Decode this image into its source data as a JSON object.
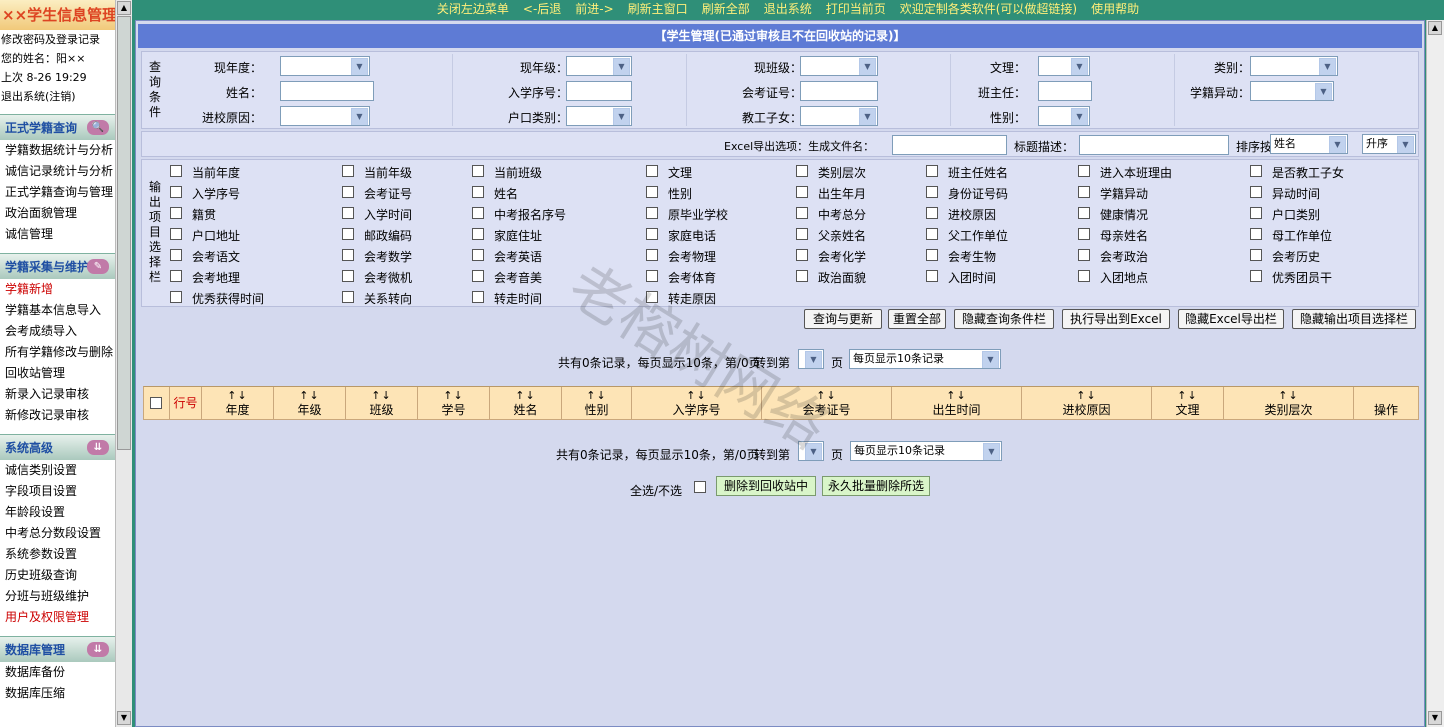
{
  "sidebar": {
    "title": "××学生信息管理",
    "user_links": [
      "修改密码及登录记录",
      "您的姓名：阳××",
      "上次 8-26 19:29",
      "退出系统(注销)"
    ],
    "sections": [
      {
        "title": "正式学籍查询",
        "icon": "magnify-icon",
        "items": [
          {
            "label": "学籍数据统计与分析",
            "highlight": false
          },
          {
            "label": "诚信记录统计与分析",
            "highlight": false
          },
          {
            "label": "正式学籍查询与管理",
            "highlight": false
          },
          {
            "label": "政治面貌管理",
            "highlight": false
          },
          {
            "label": "诚信管理",
            "highlight": false
          }
        ]
      },
      {
        "title": "学籍采集与维护",
        "icon": "edit-icon",
        "items": [
          {
            "label": "学籍新增",
            "highlight": true
          },
          {
            "label": "学籍基本信息导入",
            "highlight": false
          },
          {
            "label": "会考成绩导入",
            "highlight": false
          },
          {
            "label": "所有学籍修改与删除",
            "highlight": false
          },
          {
            "label": "回收站管理",
            "highlight": false
          },
          {
            "label": "新录入记录审核",
            "highlight": false
          },
          {
            "label": "新修改记录审核",
            "highlight": false
          }
        ]
      },
      {
        "title": "系统高级",
        "icon": "arrow-down-icon",
        "items": [
          {
            "label": "诚信类别设置",
            "highlight": false
          },
          {
            "label": "字段项目设置",
            "highlight": false
          },
          {
            "label": "年龄段设置",
            "highlight": false
          },
          {
            "label": "中考总分数段设置",
            "highlight": false
          },
          {
            "label": "系统参数设置",
            "highlight": false
          },
          {
            "label": "历史班级查询",
            "highlight": false
          },
          {
            "label": "分班与班级维护",
            "highlight": false
          },
          {
            "label": "用户及权限管理",
            "highlight": true
          }
        ]
      },
      {
        "title": "数据库管理",
        "icon": "arrow-down-icon",
        "items": [
          {
            "label": "数据库备份",
            "highlight": false
          },
          {
            "label": "数据库压缩",
            "highlight": false
          }
        ]
      }
    ]
  },
  "topnav": [
    "关闭左边菜单",
    "<-后退",
    "前进->",
    "刷新主窗口",
    "刷新全部",
    "退出系统",
    "打印当前页",
    "欢迎定制各类软件(可以做超链接)",
    "使用帮助"
  ],
  "page_title": "【学生管理(已通过审核且不在回收站的记录)】",
  "query": {
    "section_label": "查询条件",
    "row1": [
      {
        "label": "现年度：",
        "type": "select"
      },
      {
        "label": "现年级：",
        "type": "select"
      },
      {
        "label": "现班级：",
        "type": "select"
      },
      {
        "label": "文理：",
        "type": "select"
      },
      {
        "label": "类别：",
        "type": "select"
      }
    ],
    "row2": [
      {
        "label": "姓名：",
        "type": "input"
      },
      {
        "label": "入学序号：",
        "type": "input"
      },
      {
        "label": "会考证号：",
        "type": "input"
      },
      {
        "label": "班主任：",
        "type": "input"
      },
      {
        "label": "学籍异动：",
        "type": "select"
      }
    ],
    "row3": [
      {
        "label": "进校原因：",
        "type": "select"
      },
      {
        "label": "户口类别：",
        "type": "select"
      },
      {
        "label": "教工子女：",
        "type": "select"
      },
      {
        "label": "性别：",
        "type": "select"
      }
    ]
  },
  "export": {
    "label": "Excel导出选项：生成文件名：",
    "title_label": "标题描述：",
    "sort_label": "排序按",
    "sort_value": "姓名",
    "order_value": "升序"
  },
  "output": {
    "section_label": "输出项目选择栏",
    "rows": [
      [
        "当前年度",
        "当前年级",
        "当前班级",
        "文理",
        "类别层次",
        "班主任姓名",
        "进入本班理由",
        "是否教工子女"
      ],
      [
        "入学序号",
        "会考证号",
        "姓名",
        "性别",
        "出生年月",
        "身份证号码",
        "学籍异动",
        "异动时间"
      ],
      [
        "籍贯",
        "入学时间",
        "中考报名序号",
        "原毕业学校",
        "中考总分",
        "进校原因",
        "健康情况",
        "户口类别"
      ],
      [
        "户口地址",
        "邮政编码",
        "家庭住址",
        "家庭电话",
        "父亲姓名",
        "父工作单位",
        "母亲姓名",
        "母工作单位"
      ],
      [
        "会考语文",
        "会考数学",
        "会考英语",
        "会考物理",
        "会考化学",
        "会考生物",
        "会考政治",
        "会考历史"
      ],
      [
        "会考地理",
        "会考微机",
        "会考音美",
        "会考体育",
        "政治面貌",
        "入团时间",
        "入团地点",
        "优秀团员干"
      ],
      [
        "优秀获得时间",
        "关系转向",
        "转走时间",
        "转走原因"
      ]
    ]
  },
  "buttons": {
    "query": "查询与更新",
    "reset": "重置全部",
    "hide_query": "隐藏查询条件栏",
    "export": "执行导出到Excel",
    "hide_excel": "隐藏Excel导出栏",
    "hide_output": "隐藏输出项目选择栏"
  },
  "pager": {
    "summary": "共有0条记录，每页显示10条，第/0页",
    "goto": "转到第",
    "page": "页",
    "per_page": "每页显示10条记录"
  },
  "table": {
    "row_no": "行号",
    "sort_arrows": "↑↓",
    "columns": [
      "年度",
      "年级",
      "班级",
      "学号",
      "姓名",
      "性别",
      "入学序号",
      "会考证号",
      "出生时间",
      "进校原因",
      "文理",
      "类别层次"
    ],
    "action": "操作"
  },
  "bottom": {
    "select_all": "全选/不选",
    "recycle": "删除到回收站中",
    "delete": "永久批量删除所选"
  },
  "watermark": "老榕树网络"
}
